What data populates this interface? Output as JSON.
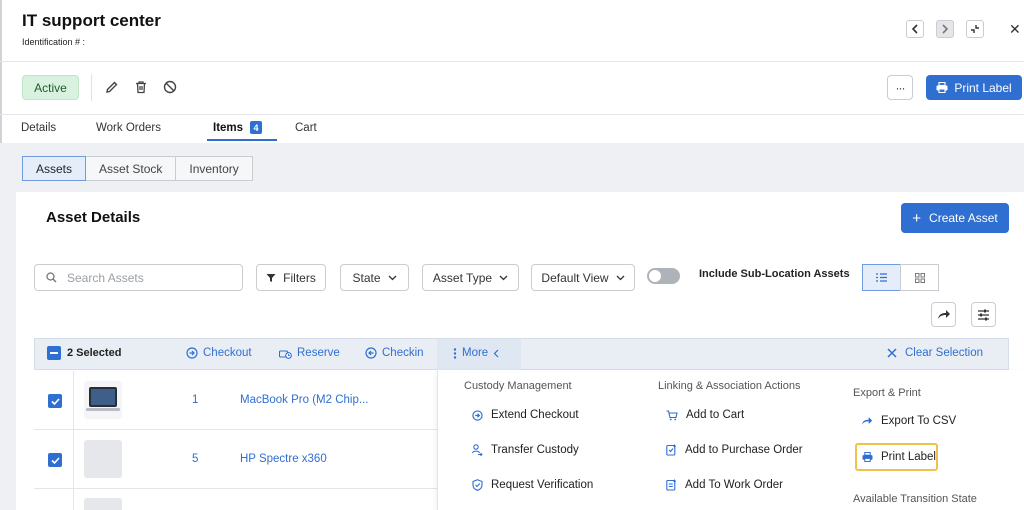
{
  "header": {
    "title": "IT support center",
    "identification_label": "Identification # :"
  },
  "toolbar": {
    "status": "Active",
    "more_label": "···",
    "print_label": "Print Label"
  },
  "tabs": [
    {
      "label": "Details"
    },
    {
      "label": "Work Orders"
    },
    {
      "label": "Items",
      "count": "4",
      "active": true
    },
    {
      "label": "Cart"
    }
  ],
  "subtabs": [
    {
      "label": "Assets",
      "active": true
    },
    {
      "label": "Asset Stock"
    },
    {
      "label": "Inventory"
    }
  ],
  "section": {
    "title": "Asset Details",
    "create_label": "Create Asset"
  },
  "filters": {
    "search_placeholder": "Search Assets",
    "filters_label": "Filters",
    "state_label": "State",
    "asset_type_label": "Asset Type",
    "view_label": "Default View",
    "sublocation_label": "Include Sub-Location Assets",
    "sublocation_on": false
  },
  "selection_bar": {
    "selected_text": "2 Selected",
    "checkout": "Checkout",
    "reserve": "Reserve",
    "checkin": "Checkin",
    "more": "More",
    "clear": "Clear Selection"
  },
  "rows": [
    {
      "id": "1",
      "name": "MacBook Pro (M2 Chip..."
    },
    {
      "id": "5",
      "name": "HP Spectre x360"
    }
  ],
  "more_menu": {
    "custody": {
      "heading": "Custody Management",
      "items": [
        "Extend Checkout",
        "Transfer Custody",
        "Request Verification"
      ]
    },
    "linking": {
      "heading": "Linking & Association Actions",
      "items": [
        "Add to Cart",
        "Add to Purchase Order",
        "Add To Work Order"
      ]
    },
    "export": {
      "heading": "Export & Print",
      "items": [
        "Export To CSV",
        "Print Label"
      ],
      "next_heading": "Available Transition State"
    }
  },
  "colors": {
    "accent": "#2f6fd1",
    "active_badge_bg": "#d9f2df",
    "highlight": "#f1c24b"
  }
}
